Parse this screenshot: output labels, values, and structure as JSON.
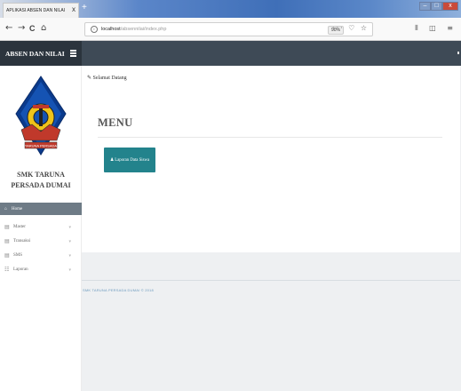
{
  "browser": {
    "tab_title": "APLIKASI ABSEN DAN NILAI",
    "tab_close": "x",
    "new_tab": "+",
    "url_host": "localhost",
    "url_path": "/absennilai/index.php",
    "zoom": "90%",
    "url_actions": "··· ♡ ☆",
    "toolbar_icons": "⫴ ◫ ≡",
    "back_icon": "←",
    "forward_icon": "→",
    "reload_icon": "C",
    "home_icon": "⌂",
    "window_min": "–",
    "window_max": "□",
    "window_close": "x"
  },
  "app": {
    "brand": "ABSEN DAN NILAI"
  },
  "sidebar": {
    "school_line1": "SMK TARUNA",
    "school_line2": "PERSADA DUMAI",
    "logo_banner": "TARUNA PERSADA",
    "items": [
      {
        "label": "Home",
        "icon": "⌂",
        "active": true
      },
      {
        "label": "Master",
        "icon": "▤",
        "caret": "▾"
      },
      {
        "label": "Transaksi",
        "icon": "▤",
        "caret": "▾"
      },
      {
        "label": "SMS",
        "icon": "▤",
        "caret": "▾"
      },
      {
        "label": "Laporan",
        "icon": "☷",
        "caret": "▾"
      }
    ]
  },
  "main": {
    "welcome": "Selamat Datang",
    "welcome_icon": "✎",
    "heading": "MENU",
    "report_button": "Laporan Data Siswa",
    "report_button_icon": "♟"
  },
  "footer": {
    "text": "SMK TARUNA PERSADA DUMAI © 2018"
  },
  "colors": {
    "header": "#3e4a56",
    "brand_bg": "#2b343d",
    "active_menu": "#6e7b86",
    "button": "#23838c"
  }
}
